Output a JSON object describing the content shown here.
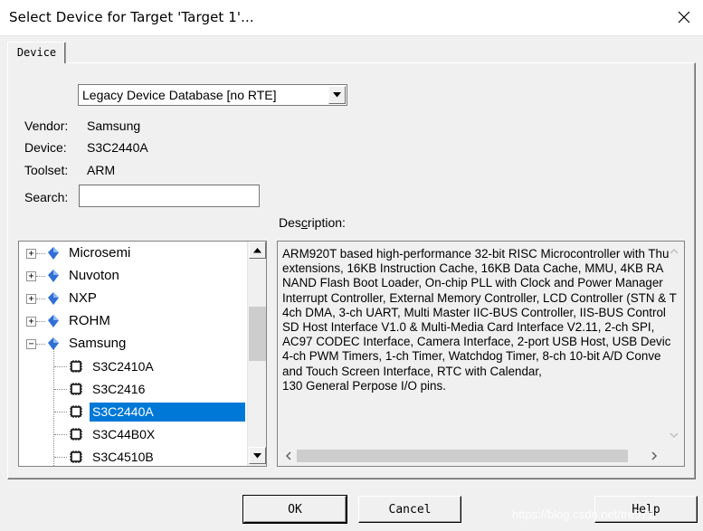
{
  "window": {
    "title": "Select Device for Target 'Target 1'..."
  },
  "tab": {
    "label": "Device"
  },
  "database_select": {
    "value": "Legacy Device Database [no RTE]"
  },
  "info": {
    "vendor_label": "Vendor:",
    "vendor_value": "Samsung",
    "device_label": "Device:",
    "device_value": "S3C2440A",
    "toolset_label": "Toolset:",
    "toolset_value": "ARM",
    "search_label": "Search:",
    "search_value": ""
  },
  "description": {
    "label_prefix": "Des",
    "label_underlined": "c",
    "label_suffix": "ription:",
    "text": "ARM920T based high-performance 32-bit RISC Microcontroller with Thu\nextensions, 16KB Instruction Cache, 16KB Data Cache, MMU, 4KB RA\nNAND Flash Boot Loader, On-chip PLL with Clock and Power Manager\nInterrupt Controller, External Memory Controller, LCD Controller (STN & T\n4ch DMA, 3-ch UART, Multi Master IIC-BUS Controller, IIS-BUS Control\nSD Host Interface V1.0 & Multi-Media Card Interface V2.11, 2-ch SPI,\nAC97 CODEC Interface, Camera Interface, 2-port USB Host, USB Devic\n4-ch PWM Timers, 1-ch Timer, Watchdog Timer, 8-ch 10-bit A/D Conve\nand Touch Screen Interface, RTC with Calendar,\n130 General Perpose I/O pins."
  },
  "tree": {
    "vendors": [
      {
        "name": "Microsemi",
        "expand": "+"
      },
      {
        "name": "Nuvoton",
        "expand": "+"
      },
      {
        "name": "NXP",
        "expand": "+"
      },
      {
        "name": "ROHM",
        "expand": "+"
      },
      {
        "name": "Samsung",
        "expand": "−"
      }
    ],
    "devices": [
      {
        "name": "S3C2410A",
        "selected": false
      },
      {
        "name": "S3C2416",
        "selected": false
      },
      {
        "name": "S3C2440A",
        "selected": true
      },
      {
        "name": "S3C44B0X",
        "selected": false
      },
      {
        "name": "S3C4510B",
        "selected": false
      }
    ]
  },
  "buttons": {
    "ok": "OK",
    "cancel": "Cancel",
    "help": "Help"
  },
  "watermark": "https://blog.csdn.net/tre571",
  "colors": {
    "selection": "#0078d7",
    "vendor_icon": "#2f6fd6"
  },
  "icons": {
    "close": "close-icon",
    "dropdown": "chevron-down-icon",
    "vendor": "diamond-icon",
    "device": "chip-icon"
  }
}
